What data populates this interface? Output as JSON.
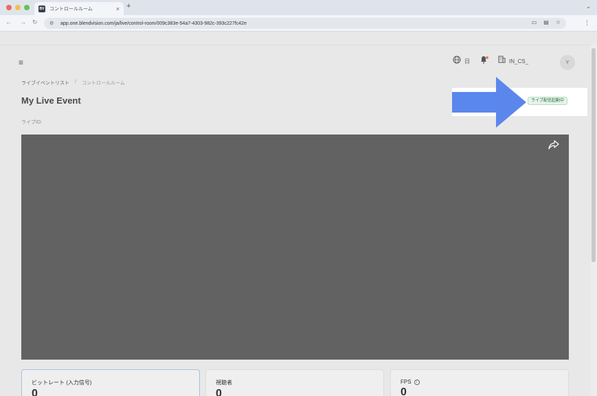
{
  "browser": {
    "tab_title": "コントロールルーム",
    "favicon_text": "BV",
    "tab_close": "×",
    "new_tab": "+",
    "tab_menu": "⌄",
    "url": "app.one.blendvision.com/ja/live/control-room/009c383e-54a7-4303-982c-393c227fc42e"
  },
  "header": {
    "language": "日",
    "org_name": "IN_CS_",
    "avatar_initial": "Y"
  },
  "breadcrumb": {
    "items": [
      "ライブイベントリスト",
      "コントロールルーム"
    ],
    "separator": "/"
  },
  "page": {
    "title": "My Live Event",
    "live_id_label": "ライブID:",
    "status": "ライブ配信起動中"
  },
  "stats": [
    {
      "label": "ビットレート (入力信号)",
      "value": "0"
    },
    {
      "label": "視聴者",
      "value": "0"
    },
    {
      "label": "FPS",
      "value": "0"
    }
  ],
  "colors": {
    "arrow": "#5b87ed",
    "player_bg": "#626262",
    "status_bg": "#e5f3e9",
    "status_text": "#2d6b3f"
  },
  "icons": {
    "share": "share-icon",
    "globe": "globe-icon",
    "bell": "bell-icon",
    "org": "building-icon",
    "menu": "hamburger-icon",
    "info": "info-icon"
  }
}
